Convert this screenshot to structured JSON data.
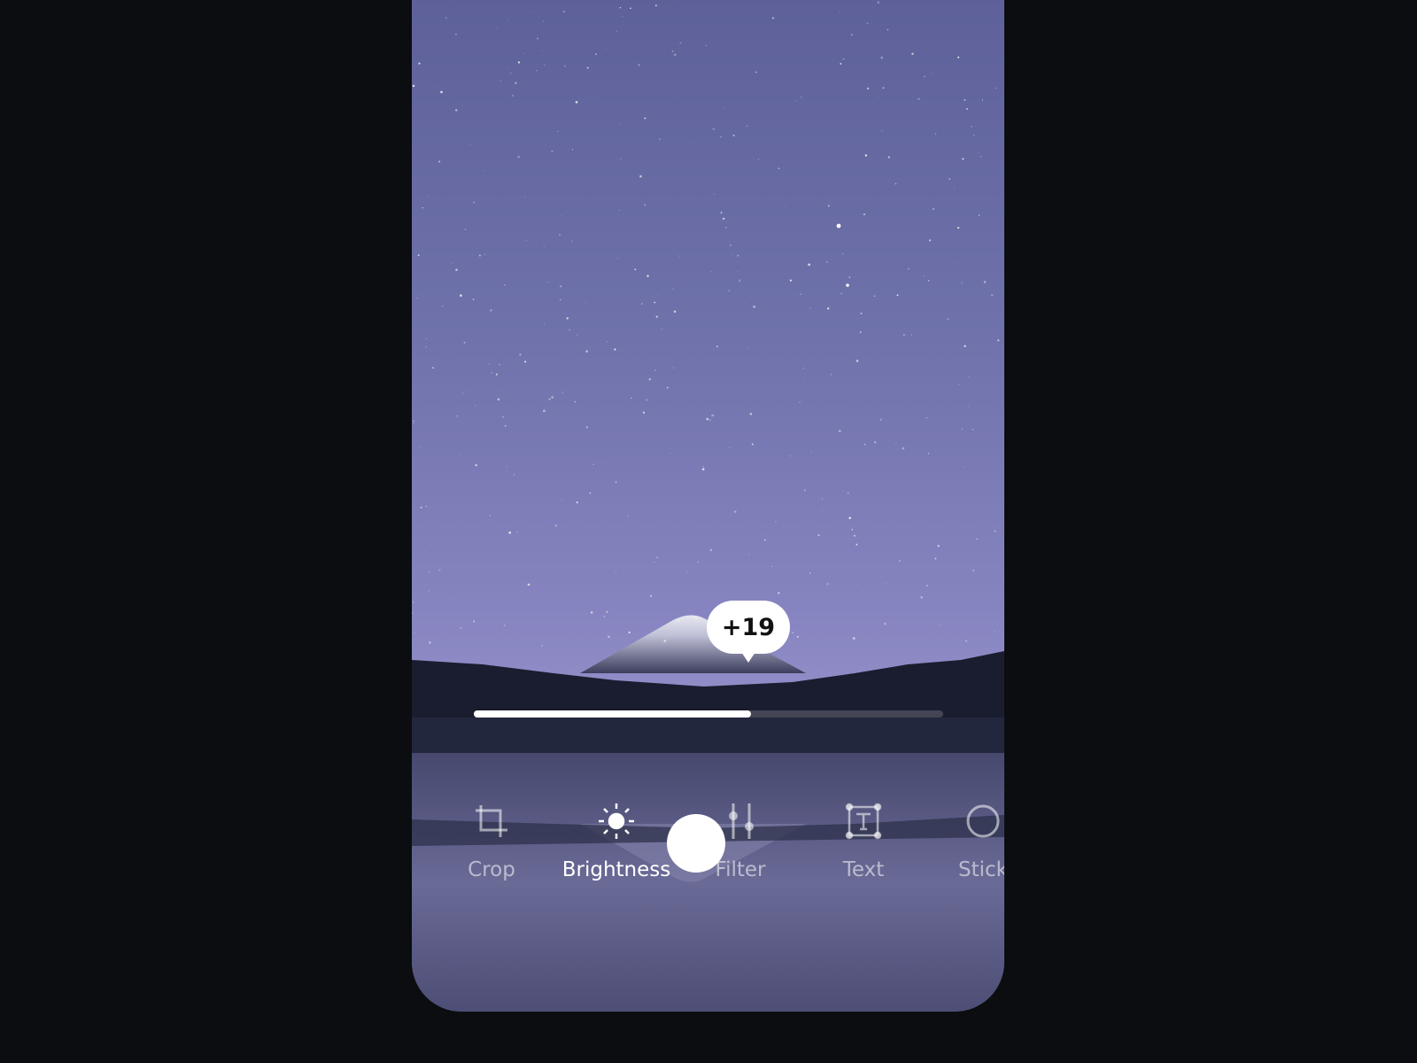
{
  "adjustment": {
    "name": "Brightness",
    "value_label": "+19",
    "slider_fraction": 0.59
  },
  "tools": [
    {
      "label": "Crop",
      "icon": "crop-icon",
      "active": false
    },
    {
      "label": "Brightness",
      "icon": "sun-icon",
      "active": true
    },
    {
      "label": "Filter",
      "icon": "sliders-icon",
      "active": false
    },
    {
      "label": "Text",
      "icon": "text-box-icon",
      "active": false
    },
    {
      "label": "Stick",
      "icon": "sticker-icon",
      "active": false
    }
  ],
  "colors": {
    "background": "#0c0d10",
    "accent": "#ffffff"
  }
}
